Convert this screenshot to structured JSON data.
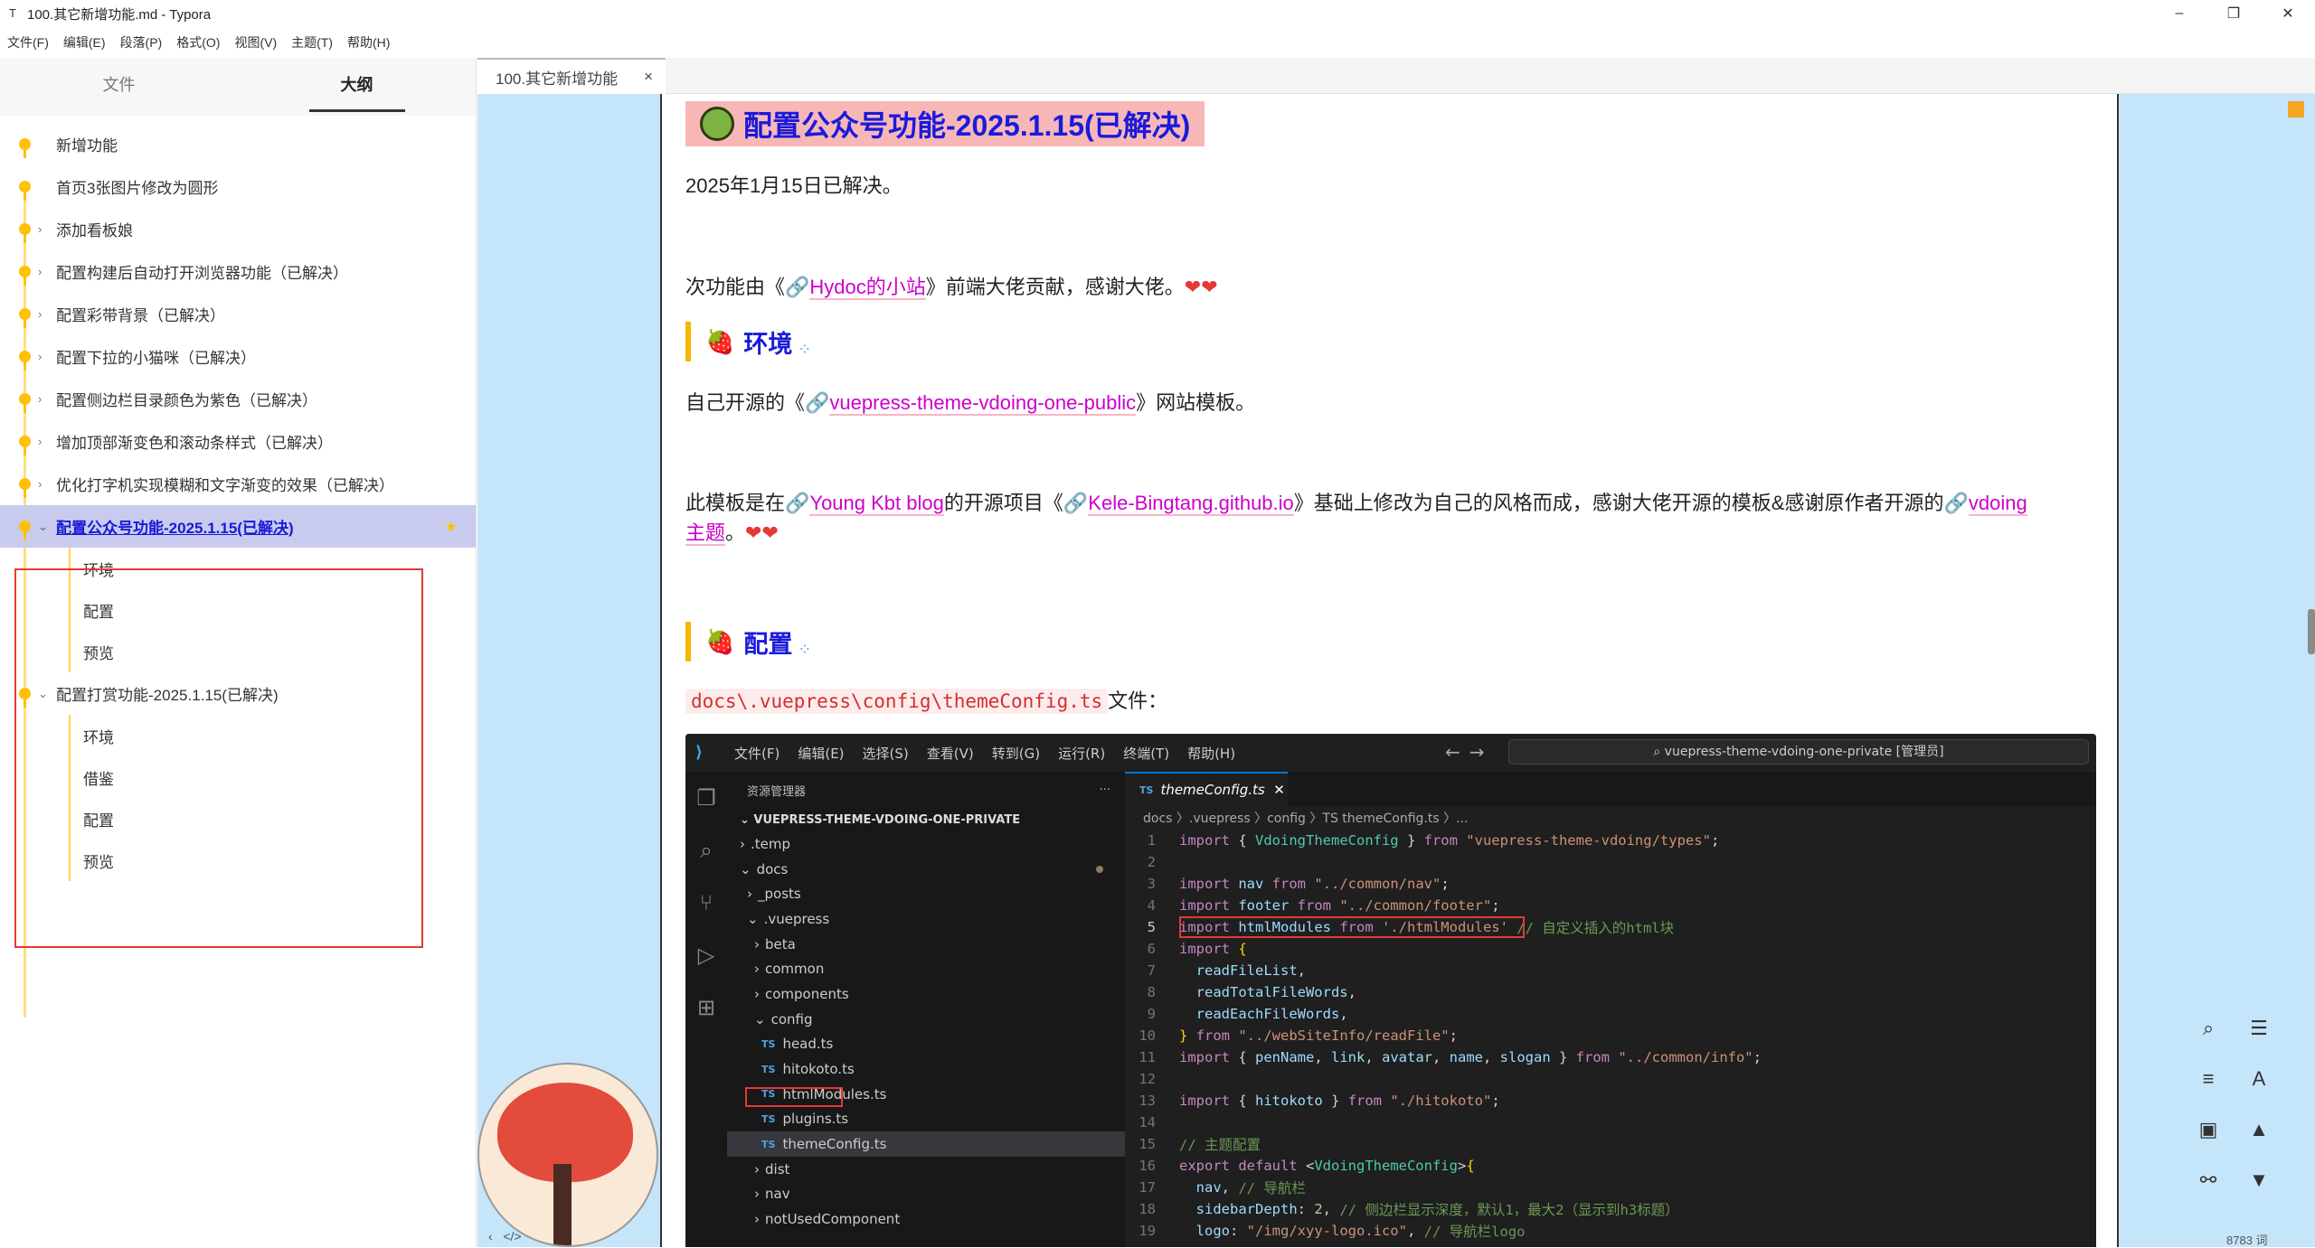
{
  "window": {
    "title": "100.其它新增功能.md - Typora",
    "minimize": "–",
    "maximize": "❐",
    "close": "✕"
  },
  "menu": [
    "文件(F)",
    "编辑(E)",
    "段落(P)",
    "格式(O)",
    "视图(V)",
    "主题(T)",
    "帮助(H)"
  ],
  "sidebar": {
    "tabs": [
      "文件",
      "大纲"
    ],
    "active_tab": "大纲",
    "outline": [
      {
        "label": "新增功能",
        "expandable": false
      },
      {
        "label": "首页3张图片修改为圆形",
        "expandable": false
      },
      {
        "label": "添加看板娘",
        "expandable": true
      },
      {
        "label": "配置构建后自动打开浏览器功能（已解决）",
        "expandable": true
      },
      {
        "label": "配置彩带背景（已解决）",
        "expandable": true
      },
      {
        "label": "配置下拉的小猫咪（已解决）",
        "expandable": true
      },
      {
        "label": "配置侧边栏目录颜色为紫色（已解决）",
        "expandable": true
      },
      {
        "label": "增加顶部渐变色和滚动条样式（已解决）",
        "expandable": true
      },
      {
        "label": "优化打字机实现模糊和文字渐变的效果（已解决）",
        "expandable": true
      }
    ],
    "active_item": {
      "label": "配置公众号功能-2025.1.15(已解决)",
      "children": [
        "环境",
        "配置",
        "预览"
      ]
    },
    "next_item": {
      "label": "配置打赏功能-2025.1.15(已解决)",
      "children": [
        "环境",
        "借鉴",
        "配置",
        "预览"
      ]
    }
  },
  "tab": {
    "label": "100.其它新增功能",
    "close": "×"
  },
  "doc": {
    "h2": "配置公众号功能-2025.1.15(已解决)",
    "p1": "2025年1月15日已解决。",
    "p2": {
      "pre": "次功能由《",
      "link": "Hydoc的小站",
      "post": "》前端大佬贡献，感谢大佬。"
    },
    "h3_env": "环境",
    "p3": {
      "pre": "自己开源的《",
      "link": "vuepress-theme-vdoing-one-public",
      "post": "》网站模板。"
    },
    "p4": {
      "pre": "此模板是在",
      "link1": "Young Kbt blog",
      "mid1": "的开源项目《",
      "link2": "Kele-Bingtang.github.io",
      "mid2": "》基础上修改为自己的风格而成，感谢大佬开源的模板&感谢原作者开源的",
      "link3a": "vdoing",
      "link3b": "主题",
      "post": "。"
    },
    "h3_config": "配置",
    "path_code": "docs\\.vuepress\\config\\themeConfig.ts",
    "path_suffix": "文件："
  },
  "vscode": {
    "menu": [
      "文件(F)",
      "编辑(E)",
      "选择(S)",
      "查看(V)",
      "转到(G)",
      "运行(R)",
      "终端(T)",
      "帮助(H)"
    ],
    "search": "vuepress-theme-vdoing-one-private [管理员]",
    "explorer_title": "资源管理器",
    "root": "VUEPRESS-THEME-VDOING-ONE-PRIVATE",
    "tree": [
      {
        "label": ".temp",
        "indent": 1,
        "type": "folder-closed"
      },
      {
        "label": "docs",
        "indent": 1,
        "type": "folder-open",
        "modified": true
      },
      {
        "label": "_posts",
        "indent": 2,
        "type": "folder-closed"
      },
      {
        "label": ".vuepress",
        "indent": 2,
        "type": "folder-open"
      },
      {
        "label": "beta",
        "indent": 3,
        "type": "folder-closed"
      },
      {
        "label": "common",
        "indent": 3,
        "type": "folder-closed"
      },
      {
        "label": "components",
        "indent": 3,
        "type": "folder-closed"
      },
      {
        "label": "config",
        "indent": 3,
        "type": "folder-open"
      },
      {
        "label": "head.ts",
        "indent": 4,
        "type": "ts"
      },
      {
        "label": "hitokoto.ts",
        "indent": 4,
        "type": "ts"
      },
      {
        "label": "htmlModules.ts",
        "indent": 4,
        "type": "ts"
      },
      {
        "label": "plugins.ts",
        "indent": 4,
        "type": "ts"
      },
      {
        "label": "themeConfig.ts",
        "indent": 4,
        "type": "ts",
        "selected": true
      },
      {
        "label": "dist",
        "indent": 3,
        "type": "folder-closed"
      },
      {
        "label": "nav",
        "indent": 3,
        "type": "folder-closed"
      },
      {
        "label": "notUsedComponent",
        "indent": 3,
        "type": "folder-closed"
      }
    ],
    "editor_tab": "themeConfig.ts",
    "breadcrumb": "docs 〉.vuepress 〉config 〉TS themeConfig.ts 〉...",
    "current_line": 5
  },
  "wordcount": "8783 词",
  "colors": {
    "accent": "#1a1adb",
    "link": "#cc00cc",
    "outline_active_bg": "#c9cbee",
    "bg_blue": "#c5e5fb",
    "rail": "#ffc107"
  }
}
